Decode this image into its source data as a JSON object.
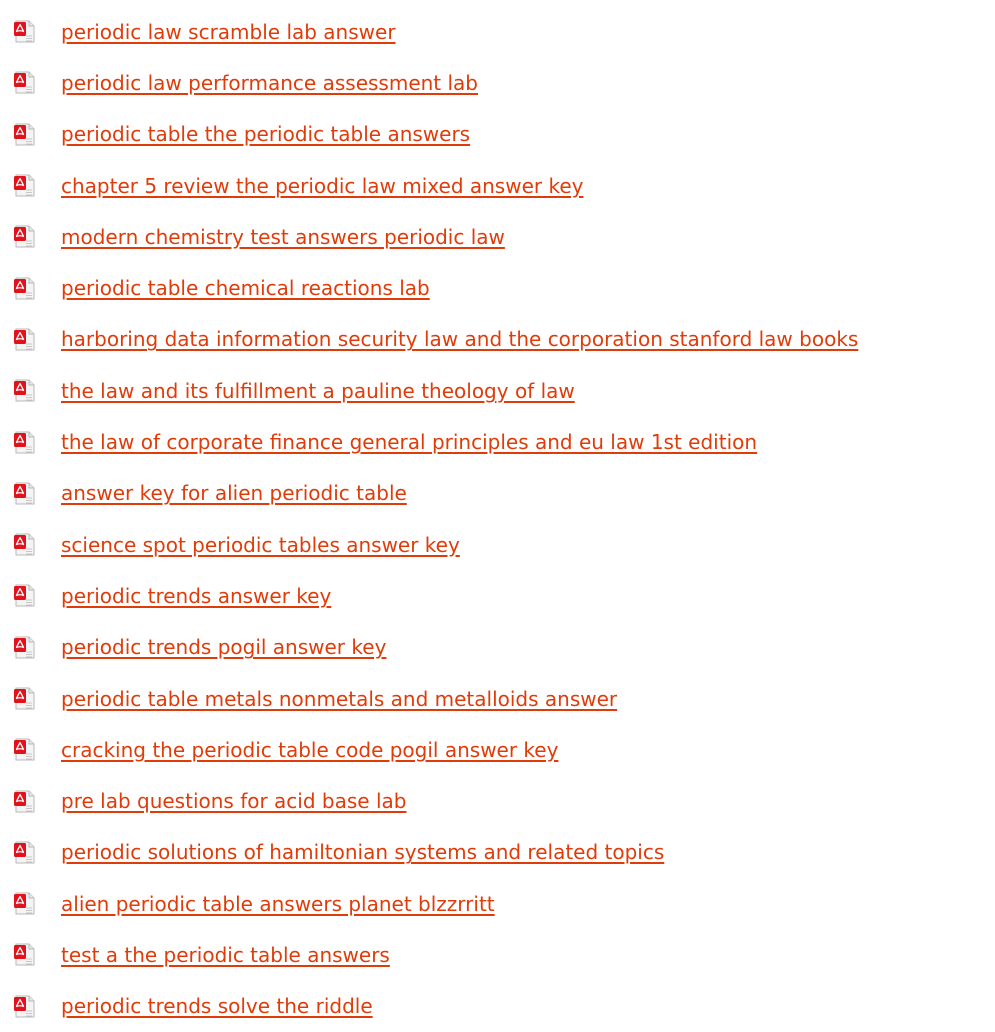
{
  "colors": {
    "link": "#e03c0a",
    "icon_red": "#e1121b",
    "icon_paper": "#f4f4f4",
    "icon_border": "#b9b9b9"
  },
  "icon": "pdf-file-icon",
  "items": [
    {
      "label": "periodic law scramble lab answer"
    },
    {
      "label": "periodic law performance assessment lab"
    },
    {
      "label": "periodic table the periodic table answers"
    },
    {
      "label": "chapter 5 review the periodic law mixed answer key"
    },
    {
      "label": "modern chemistry test answers periodic law"
    },
    {
      "label": "periodic table chemical reactions lab"
    },
    {
      "label": "harboring data information security law and the corporation stanford law books"
    },
    {
      "label": "the law and its fulfillment a pauline theology of law"
    },
    {
      "label": "the law of corporate finance general principles and eu law 1st edition"
    },
    {
      "label": "answer key for alien periodic table"
    },
    {
      "label": "science spot periodic tables answer key"
    },
    {
      "label": "periodic trends answer key"
    },
    {
      "label": "periodic trends pogil answer key"
    },
    {
      "label": "periodic table metals nonmetals and metalloids answer"
    },
    {
      "label": "cracking the periodic table code pogil answer key"
    },
    {
      "label": "pre lab questions for acid base lab"
    },
    {
      "label": "periodic solutions of hamiltonian systems and related topics"
    },
    {
      "label": "alien periodic table answers planet blzzrritt"
    },
    {
      "label": "test a the periodic table answers"
    },
    {
      "label": "periodic trends solve the riddle"
    }
  ]
}
